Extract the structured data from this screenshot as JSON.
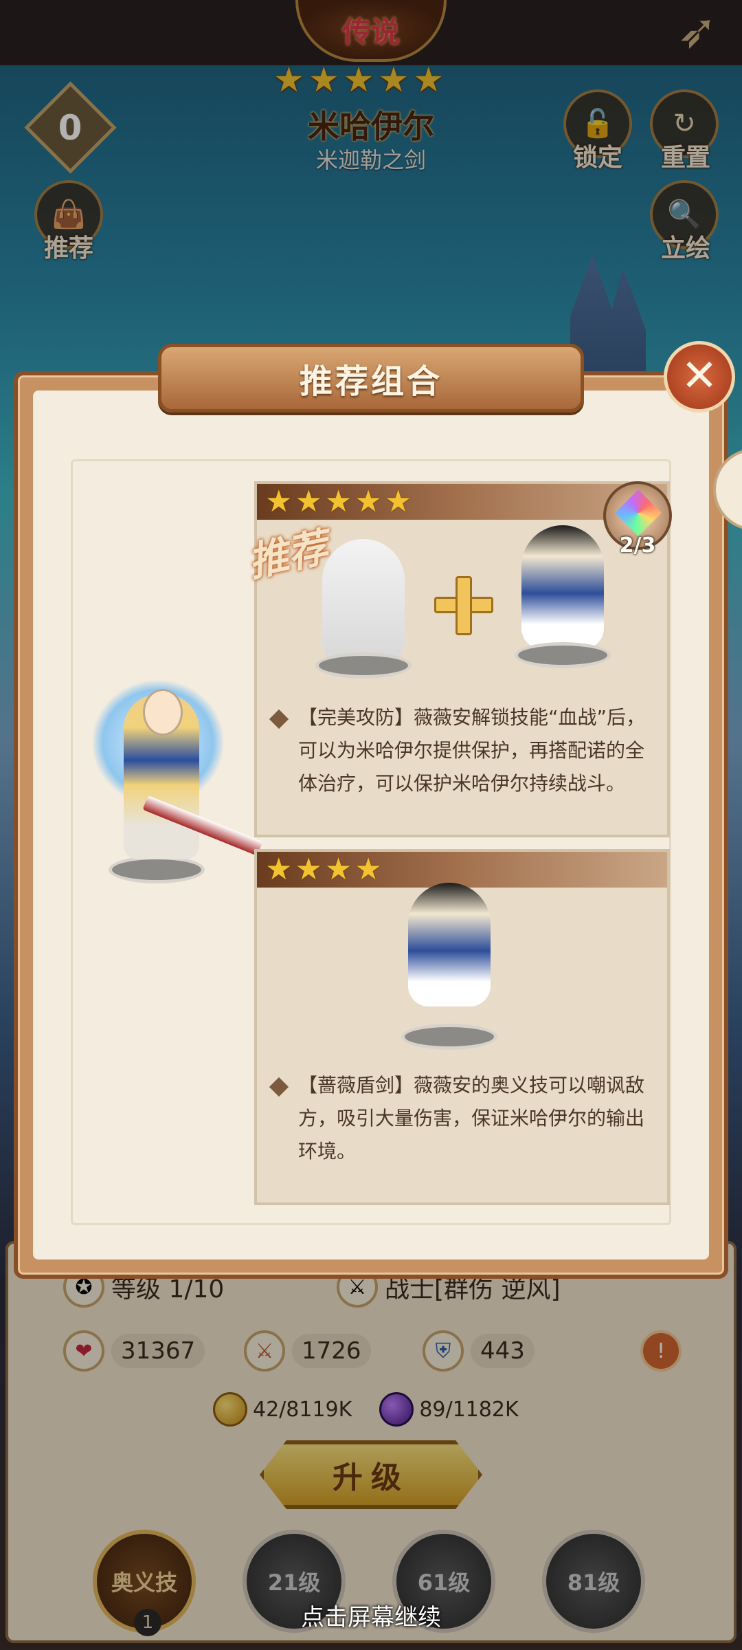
{
  "header": {
    "rarity": "传说",
    "stars": [
      "★",
      "★",
      "★",
      "★",
      "★"
    ],
    "hero_name": "米哈伊尔",
    "hero_title": "米迦勒之剑",
    "level_badge": "0",
    "back_icon": "back-arrow-icon"
  },
  "top_buttons": {
    "lock_label": "锁定",
    "reset_label": "重置",
    "recommend_label": "推荐",
    "portrait_label": "立绘"
  },
  "dialog": {
    "title": "推荐组合",
    "close_icon": "close-icon",
    "recommend_tag": "推荐",
    "combo1": {
      "stars": [
        "★",
        "★",
        "★",
        "★",
        "★"
      ],
      "gem_count": "2/3",
      "text": "【完美攻防】薇薇安解锁技能“血战”后，可以为米哈伊尔提供保护，再搭配诺的全体治疗，可以保护米哈伊尔持续战斗。"
    },
    "combo2": {
      "stars": [
        "★",
        "★",
        "★",
        "★"
      ],
      "text": "【蔷薇盾剑】薇薇安的奥义技可以嘲讽敌方，吸引大量伤害，保证米哈伊尔的输出环境。"
    }
  },
  "bottom": {
    "level_text": "等级 1/10",
    "class_text": "战士[群伤 逆风]",
    "hp": "31367",
    "atk": "1726",
    "def": "443",
    "gold": "42/8119K",
    "gem": "89/1182K",
    "upgrade_label": "升级",
    "skills": [
      "1",
      "21级",
      "61级",
      "81级"
    ],
    "ultimate_label": "奥义技",
    "continue_hint": "点击屏幕继续"
  }
}
